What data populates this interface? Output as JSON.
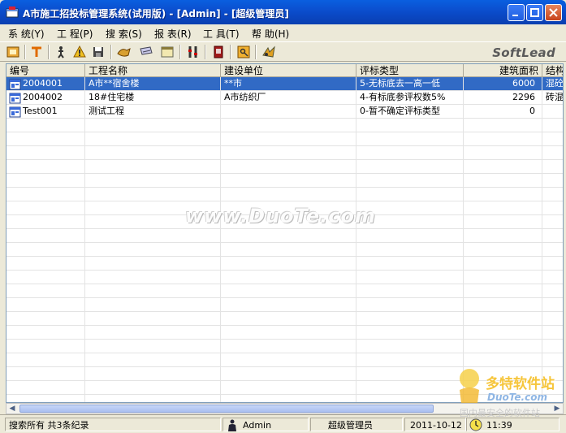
{
  "window": {
    "title": "A市施工招投标管理系统(试用版)  - [Admin] - [超级管理员]"
  },
  "menu": [
    {
      "label": "系 统(Y)"
    },
    {
      "label": "工 程(P)"
    },
    {
      "label": "搜 索(S)"
    },
    {
      "label": "报 表(R)"
    },
    {
      "label": "工 具(T)"
    },
    {
      "label": "帮 助(H)"
    }
  ],
  "toolbar": {
    "brand": "SoftLead",
    "icons": [
      "open-icon",
      "text-icon",
      "person-icon",
      "warning-icon",
      "save-icon",
      "edit-icon",
      "key-icon",
      "window-icon",
      "tools-icon",
      "book-icon",
      "lock-key-icon",
      "settings-icon"
    ]
  },
  "grid": {
    "columns": [
      "编号",
      "工程名称",
      "建设单位",
      "评标类型",
      "建筑面积",
      "结构"
    ],
    "rows": [
      {
        "id": "2004001",
        "name": "A市**宿舍楼",
        "unit": "**市",
        "type": "5-无标底去一高一低",
        "area": "6000",
        "struct": "混砼",
        "selected": true
      },
      {
        "id": "2004002",
        "name": "18#住宅楼",
        "unit": "A市纺织厂",
        "type": "4-有标底参评权数5%",
        "area": "2296",
        "struct": "砖混",
        "selected": false
      },
      {
        "id": "Test001",
        "name": "测试工程",
        "unit": "",
        "type": "0-暂不确定评标类型",
        "area": "0",
        "struct": "",
        "selected": false
      }
    ]
  },
  "status": {
    "search": "搜索所有 共3条纪录",
    "user": "Admin",
    "role": "超级管理员",
    "date": "2011-10-12",
    "time": "11:39"
  },
  "watermarks": {
    "center": "www.DuoTe.com",
    "corner_cn": "多特软件站",
    "corner_en": "DuoTe.com",
    "corner_tag": "国内最安全的软件站"
  },
  "colors": {
    "title_bar": "#0a4fcf",
    "selection": "#316ac5",
    "chrome": "#ece9d8"
  }
}
